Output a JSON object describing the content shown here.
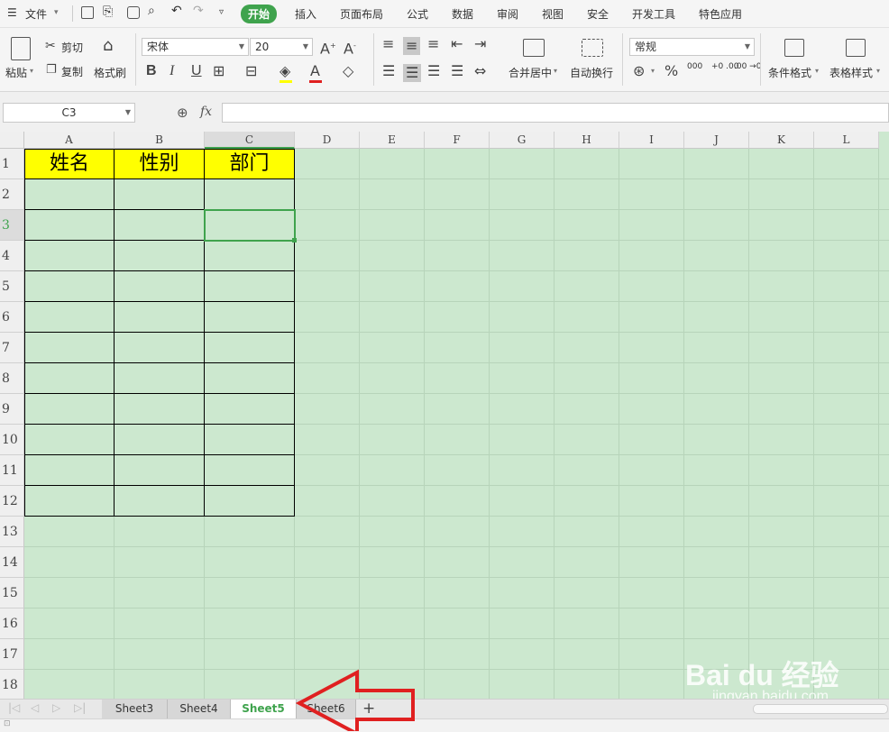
{
  "menubar": {
    "file": "文件",
    "tabs": [
      "开始",
      "插入",
      "页面布局",
      "公式",
      "数据",
      "审阅",
      "视图",
      "安全",
      "开发工具",
      "特色应用"
    ],
    "active_tab": "开始"
  },
  "ribbon": {
    "paste": "粘贴",
    "cut": "剪切",
    "copy": "复制",
    "format_painter": "格式刷",
    "font_name": "宋体",
    "font_size": "20",
    "bold": "B",
    "italic": "I",
    "underline": "U",
    "merge_center": "合并居中",
    "wrap_text": "自动换行",
    "number_format": "常规",
    "percent": "%",
    "thousands": "000",
    "inc_decimal": "+0 .00",
    "dec_decimal": ".00 →0",
    "conditional_format": "条件格式",
    "table_style": "表格样式"
  },
  "formula_bar": {
    "name_box": "C3",
    "fx": "fx",
    "value": ""
  },
  "sheet": {
    "columns": [
      "A",
      "B",
      "C",
      "D",
      "E",
      "F",
      "G",
      "H",
      "I",
      "J",
      "K",
      "L"
    ],
    "rows": [
      "1",
      "2",
      "3",
      "4",
      "5",
      "6",
      "7",
      "8",
      "9",
      "10",
      "11",
      "12",
      "13",
      "14",
      "15",
      "16",
      "17",
      "18"
    ],
    "header_cells": [
      "姓名",
      "性别",
      "部门"
    ],
    "selected_cell": "C3"
  },
  "sheet_tabs": {
    "tabs": [
      "Sheet3",
      "Sheet4",
      "Sheet5",
      "Sheet6"
    ],
    "active": "Sheet5",
    "add": "+"
  },
  "watermark": {
    "brand": "Bai du 经验",
    "url": "jingyan.baidu.com"
  },
  "colors": {
    "accent": "#3fa34d",
    "grid_background": "#cce8cf",
    "header_fill": "#ffff00",
    "arrow": "#e02020"
  }
}
